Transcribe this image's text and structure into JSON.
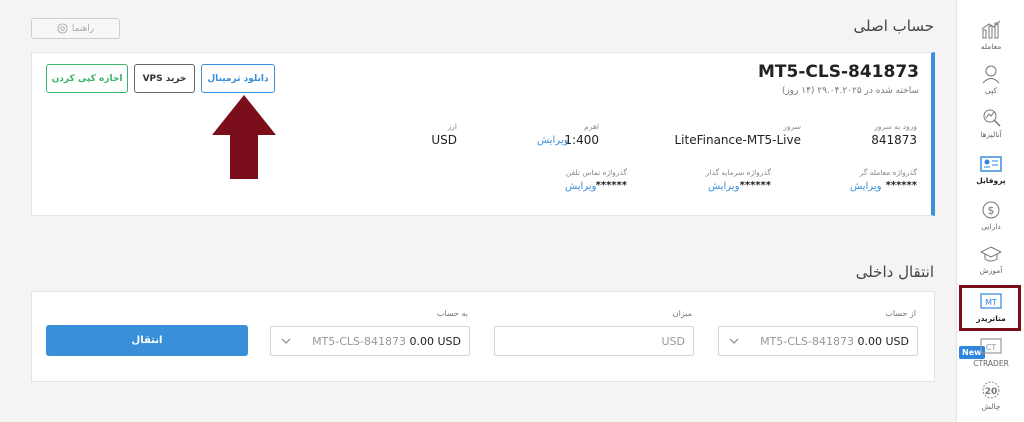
{
  "help": {
    "label": "راهنما"
  },
  "main_title": "حساب اصلی",
  "account": {
    "name": "MT5-CLS-841873",
    "created": "ساخته شده در ۲۹.۰۴.۲۰۲۵ (۱۴ روز)",
    "buttons": {
      "download": "دانلود ترمینال",
      "vps": "خرید VPS",
      "copy": "اجازه کپی کردن"
    },
    "fields": {
      "login_label": "ورود به سرور",
      "login_value": "841873",
      "server_label": "سرور",
      "server_value": "LiteFinance-MT5-Live",
      "leverage_label": "اهرم",
      "leverage_value": "1:400",
      "leverage_edit": "ویرایش",
      "currency_label": "ارز",
      "currency_value": "USD",
      "trader_pw_label": "گذرواژه معامله گر",
      "trader_pw_value": "******",
      "trader_pw_edit": "ویرایش",
      "investor_pw_label": "گذرواژه سرمایه گذار",
      "investor_pw_value": "******",
      "investor_pw_edit": "ویرایش",
      "phone_pw_label": "گذرواژه تماس تلفن",
      "phone_pw_value": "******",
      "phone_pw_edit": "ویرایش"
    }
  },
  "transfer": {
    "title": "انتقال داخلی",
    "from_label": "از حساب",
    "from_account": "MT5-CLS-841873",
    "from_amount": "0.00 USD",
    "amount_label": "میزان",
    "amount_placeholder": "USD",
    "to_label": "به حساب",
    "to_account": "MT5-CLS-841873",
    "to_amount": "0.00 USD",
    "button": "انتقال"
  },
  "sidebar": {
    "items": [
      {
        "label": "معامله",
        "icon": "chart-icon"
      },
      {
        "label": "کپی",
        "icon": "user-icon"
      },
      {
        "label": "آنالیزها",
        "icon": "analysis-icon"
      },
      {
        "label": "پروفایل",
        "icon": "profile-icon"
      },
      {
        "label": "دارایی",
        "icon": "dollar-icon"
      },
      {
        "label": "آموزش",
        "icon": "graduation-icon"
      },
      {
        "label": "متاتریدر",
        "icon": "mt-icon",
        "icon_text": "MT"
      },
      {
        "label": "CTRADER",
        "icon": "ct-icon",
        "icon_text": "CT"
      },
      {
        "label": "چالش",
        "icon": "challenge-icon",
        "icon_text": "20"
      }
    ],
    "new_badge": "New"
  },
  "colors": {
    "accent": "#3a8fd9",
    "green": "#3bb36b",
    "highlight": "#7a0f1b"
  }
}
